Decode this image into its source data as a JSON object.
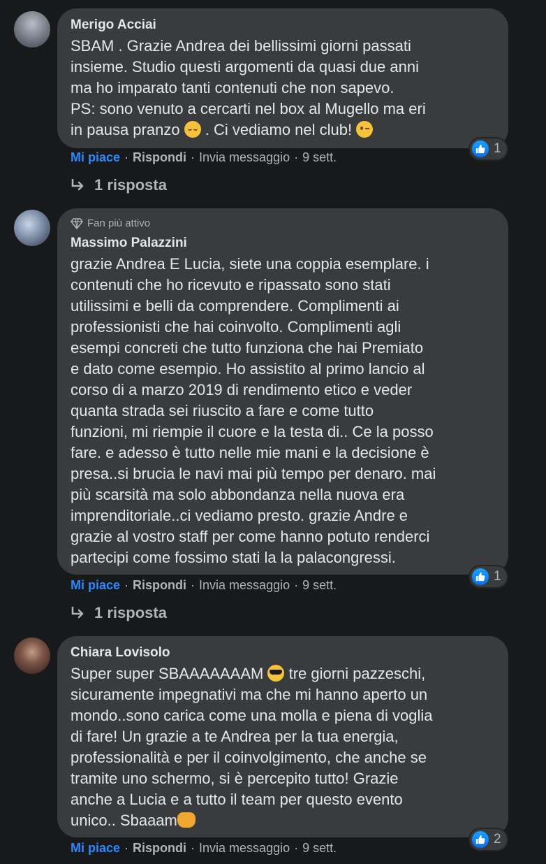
{
  "comments": [
    {
      "author": "Merigo Acciai",
      "text": "SBAM . Grazie Andrea dei bellissimi giorni passati\ninsieme. Studio questi argomenti da quasi due anni\nma ho imparato tanti contenuti che non sapevo.\nPS: sono venuto a cercarti nel box al Mugello ma eri\nin pausa pranzo ",
      "text_mid": " . Ci vediamo nel club! ",
      "reaction_count": "1",
      "like_label": "Mi piace",
      "reply_label": "Rispondi",
      "message_label": "Invia messaggio",
      "time": "9 sett.",
      "replies_label": "1 risposta"
    },
    {
      "badge": "Fan più attivo",
      "author": "Massimo Palazzini",
      "text": "grazie Andrea E Lucia, siete una coppia esemplare. i\ncontenuti che ho ricevuto e ripassato sono stati\nutilissimi e belli da comprendere. Complimenti ai\nprofessionisti che hai coinvolto. Complimenti agli\nesempi concreti che tutto funziona che hai Premiato\ne dato come esempio. Ho assistito al primo lancio al\ncorso di a marzo 2019 di rendimento etico e veder\nquanta strada sei riuscito a fare e come tutto\nfunzioni, mi riempie il cuore e la testa di.. Ce la posso\nfare. e adesso è tutto nelle mie mani e la decisione è\npresa..si brucia le navi mai più tempo per denaro. mai\npiù scarsità ma solo abbondanza nella nuova era\nimprenditoriale..ci vediamo presto. grazie Andre e\ngrazie al vostro staff per come hanno potuto renderci\npartecipi come fossimo stati la la palacongressi.",
      "reaction_count": "1",
      "like_label": "Mi piace",
      "reply_label": "Rispondi",
      "message_label": "Invia messaggio",
      "time": "9 sett.",
      "replies_label": "1 risposta"
    },
    {
      "author": "Chiara Lovisolo",
      "text": "Super super SBAAAAAAAM ",
      "text_mid": " tre giorni pazzeschi,\nsicuramente impegnativi ma che mi hanno aperto un\nmondo..sono carica come una molla e piena di voglia\ndi fare! Un grazie a te Andrea per la tua energia,\nprofessionalità e per il coinvolgimento, che anche se\ntramite uno schermo, si è percepito tutto! Grazie\nanche a Lucia e a tutto il team per questo evento\nunico.. Sbaaam",
      "reaction_count": "2",
      "like_label": "Mi piace",
      "reply_label": "Rispondi",
      "message_label": "Invia messaggio",
      "time": "9 sett."
    }
  ],
  "icons": {
    "like": "thumbs-up-icon",
    "reply_arrow": "reply-arrow-icon",
    "badge": "diamond-icon"
  },
  "colors": {
    "background": "#18191a",
    "bubble": "#3a3b3c",
    "like_active": "#2d88ff",
    "muted_text": "#b0b3b8"
  }
}
